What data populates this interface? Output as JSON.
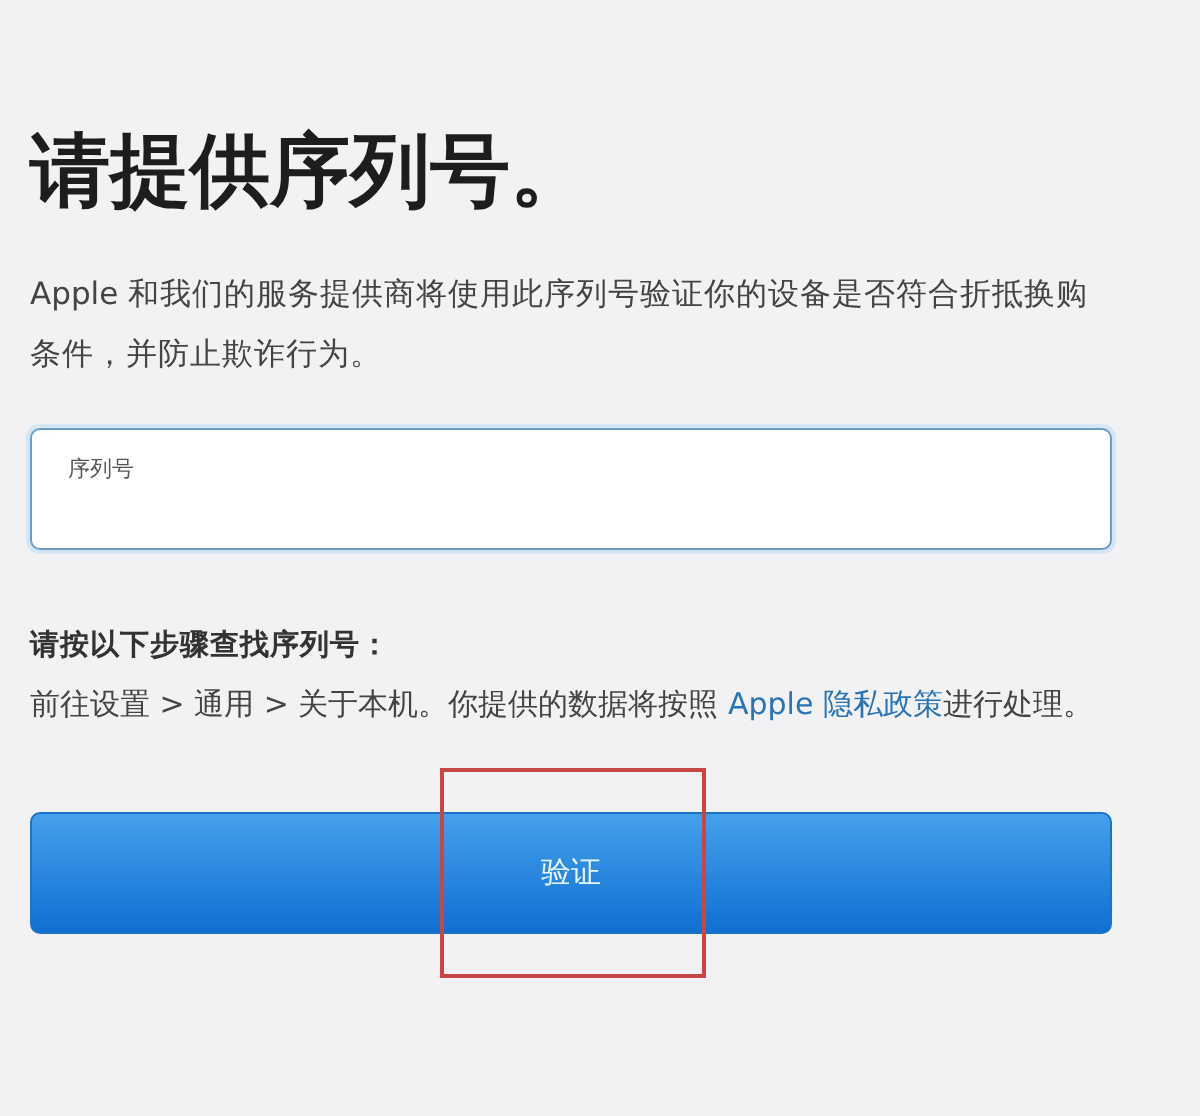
{
  "title": "请提供序列号。",
  "intro": "Apple 和我们的服务提供商将使用此序列号验证你的设备是否符合折抵换购条件，并防止欺诈行为。",
  "serial_field": {
    "label": "序列号"
  },
  "steps_heading": "请按以下步骤查找序列号：",
  "steps": {
    "before": "前往设置 > 通用 > 关于本机。你提供的数据将按照",
    "link": "Apple 隐私政策",
    "after": "进行处理。"
  },
  "verify_button": {
    "label": "验证",
    "highlighted": true
  }
}
